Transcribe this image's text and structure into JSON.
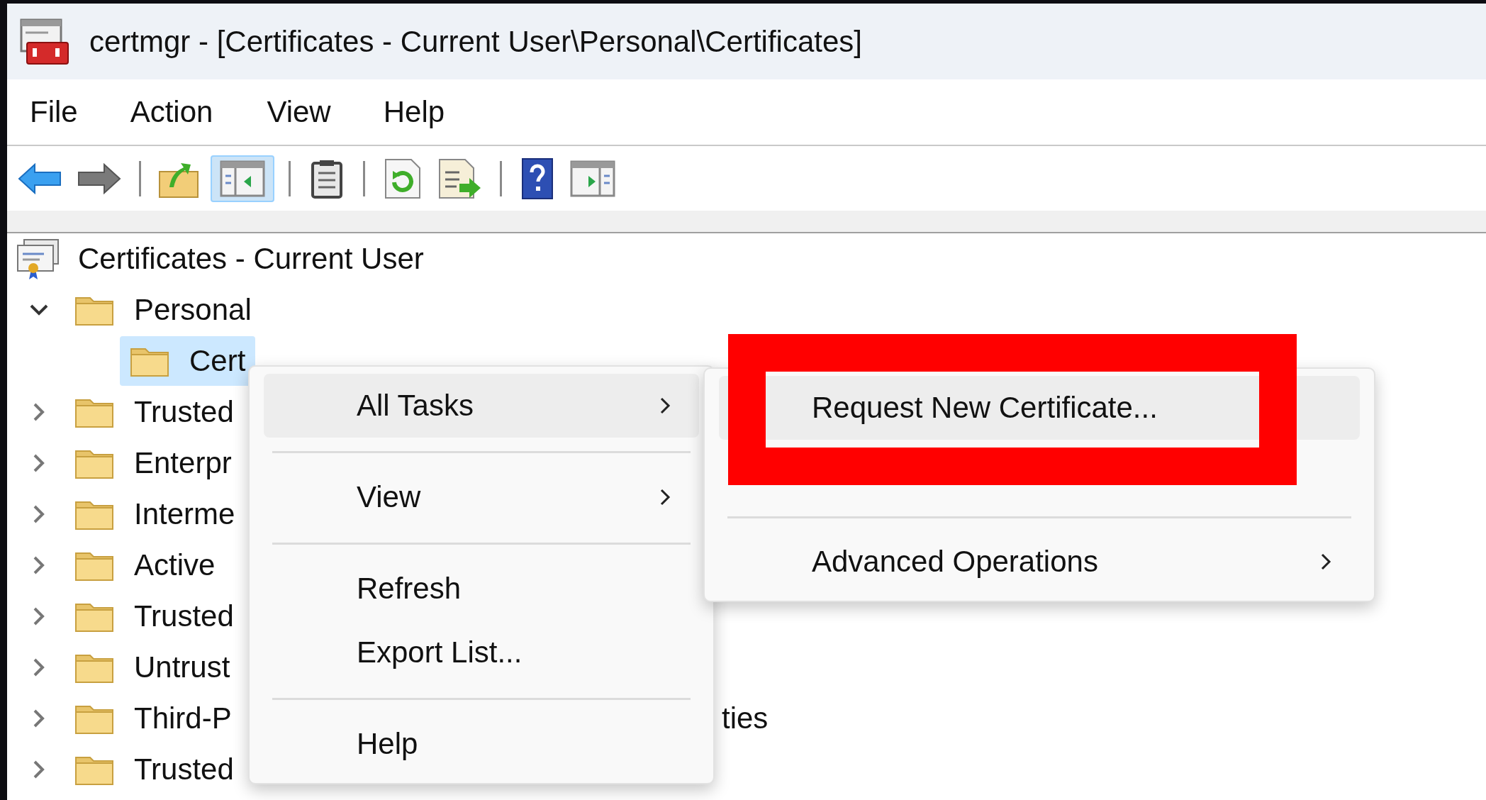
{
  "window": {
    "title": "certmgr - [Certificates - Current User\\Personal\\Certificates]"
  },
  "menu_bar": [
    "File",
    "Action",
    "View",
    "Help"
  ],
  "toolbar": [
    {
      "kind": "back",
      "selected": false
    },
    {
      "kind": "forward",
      "selected": false
    },
    {
      "kind": "separator"
    },
    {
      "kind": "up",
      "selected": false
    },
    {
      "kind": "tree-toggle",
      "selected": true
    },
    {
      "kind": "separator"
    },
    {
      "kind": "properties",
      "selected": false
    },
    {
      "kind": "separator"
    },
    {
      "kind": "refresh",
      "selected": false
    },
    {
      "kind": "export",
      "selected": false
    },
    {
      "kind": "separator"
    },
    {
      "kind": "help",
      "selected": false
    },
    {
      "kind": "action-pane",
      "selected": false
    }
  ],
  "tree": {
    "label": "Certificates - Current User",
    "children": [
      {
        "label": "Personal",
        "expanded": true,
        "selected": false,
        "children": [
          {
            "label": "Cert",
            "selected": true
          }
        ]
      },
      {
        "label": "Trusted",
        "expanded": false,
        "selected": false
      },
      {
        "label": "Enterpr",
        "expanded": false,
        "selected": false
      },
      {
        "label": "Interme",
        "expanded": false,
        "selected": false
      },
      {
        "label": "Active",
        "expanded": false,
        "selected": false
      },
      {
        "label": "Trusted",
        "expanded": false,
        "selected": false
      },
      {
        "label": "Untrust",
        "expanded": false,
        "selected": false
      },
      {
        "label": "Third-P",
        "tail": "ties",
        "expanded": false,
        "selected": false
      },
      {
        "label": "Trusted",
        "expanded": false,
        "selected": false
      }
    ]
  },
  "context_menu": {
    "items": [
      {
        "kind": "submenu",
        "label": "All Tasks",
        "selected": true
      },
      {
        "kind": "separator"
      },
      {
        "kind": "submenu",
        "label": "View",
        "selected": false
      },
      {
        "kind": "separator"
      },
      {
        "kind": "command",
        "label": "Refresh",
        "selected": false
      },
      {
        "kind": "command",
        "label": "Export List...",
        "selected": false
      },
      {
        "kind": "separator"
      },
      {
        "kind": "command",
        "label": "Help",
        "selected": false
      }
    ]
  },
  "submenu": {
    "items": [
      {
        "kind": "command",
        "label": "Request New Certificate...",
        "selected": true
      },
      {
        "kind": "separator"
      },
      {
        "kind": "submenu",
        "label": "Advanced Operations",
        "selected": false
      }
    ]
  }
}
